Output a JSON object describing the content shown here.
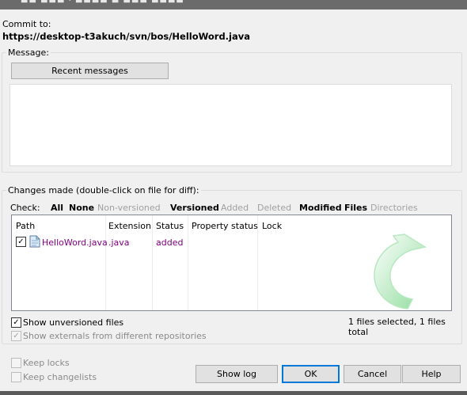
{
  "commit": {
    "label": "Commit to:",
    "url": "https://desktop-t3akuch/svn/bos/HelloWord.java"
  },
  "message": {
    "legend": "Message:",
    "recent_button": "Recent messages",
    "text": ""
  },
  "changes": {
    "legend": "Changes made (double-click on file for diff):",
    "check_label": "Check:",
    "filters": [
      {
        "label": "All",
        "enabled": true
      },
      {
        "label": "None",
        "enabled": true
      },
      {
        "label": "Non-versioned",
        "enabled": false
      },
      {
        "label": "Versioned",
        "enabled": true
      },
      {
        "label": "Added",
        "enabled": false
      },
      {
        "label": "Deleted",
        "enabled": false
      },
      {
        "label": "Modified",
        "enabled": true
      },
      {
        "label": "Files",
        "enabled": true
      },
      {
        "label": "Directories",
        "enabled": false
      }
    ],
    "columns": [
      "Path",
      "Extension",
      "Status",
      "Property status",
      "Lock"
    ],
    "rows": [
      {
        "checked": true,
        "path": "HelloWord.java",
        "extension": ".java",
        "status": "added",
        "property_status": "",
        "lock": ""
      }
    ],
    "show_unversioned": {
      "label": "Show unversioned files",
      "checked": true
    },
    "show_externals": {
      "label": "Show externals from different repositories",
      "checked": true,
      "disabled": true
    },
    "selection_info": "1 files selected, 1 files total"
  },
  "options": {
    "keep_locks": {
      "label": "Keep locks",
      "checked": false,
      "disabled": true
    },
    "keep_changelists": {
      "label": "Keep changelists",
      "checked": false,
      "disabled": true
    }
  },
  "buttons": {
    "show_log": "Show log",
    "ok": "OK",
    "cancel": "Cancel",
    "help": "Help"
  },
  "colors": {
    "modified_text": "#800080",
    "default_button_border": "#0078d7",
    "watermark_green": "#9be3a8"
  }
}
